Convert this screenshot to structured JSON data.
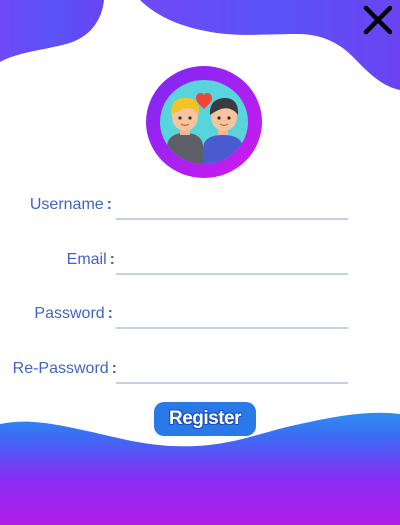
{
  "form": {
    "fields": [
      {
        "label": "Username",
        "colon": ":",
        "value": "",
        "placeholder": ""
      },
      {
        "label": "Email",
        "colon": ":",
        "value": "",
        "placeholder": ""
      },
      {
        "label": "Password",
        "colon": ":",
        "value": "",
        "placeholder": ""
      },
      {
        "label": "Re-Password",
        "colon": ":",
        "value": "",
        "placeholder": ""
      }
    ],
    "register_label": "Register"
  },
  "icons": {
    "close": "close-icon",
    "avatar": "couple-avatar-icon"
  },
  "colors": {
    "label": "#4263c6",
    "accent_blue": "#2a79e8",
    "accent_purple": "#8a22f0",
    "accent_magenta": "#c01cf0"
  }
}
